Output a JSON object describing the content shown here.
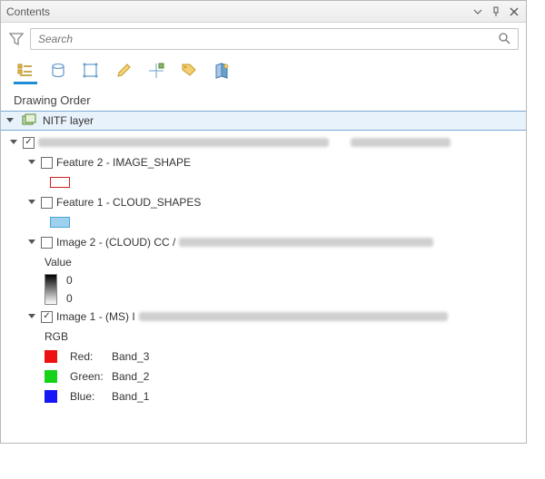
{
  "panel": {
    "title": "Contents"
  },
  "search": {
    "placeholder": "Search"
  },
  "section": {
    "heading": "Drawing Order"
  },
  "nitf": {
    "label": "NITF layer"
  },
  "tree": {
    "feature2": {
      "label": "Feature 2 - IMAGE_SHAPE"
    },
    "feature1": {
      "label": "Feature 1 - CLOUD_SHAPES"
    },
    "image2": {
      "label": "Image 2 - (CLOUD) CC / "
    },
    "valueLabel": "Value",
    "val0a": "0",
    "val0b": "0",
    "image1": {
      "label": "Image 1 - (MS) I"
    },
    "rgbLabel": "RGB",
    "red": {
      "prefix": "Red:",
      "band": "Band_3"
    },
    "green": {
      "prefix": "Green:",
      "band": "Band_2"
    },
    "blue": {
      "prefix": "Blue:",
      "band": "Band_1"
    }
  }
}
